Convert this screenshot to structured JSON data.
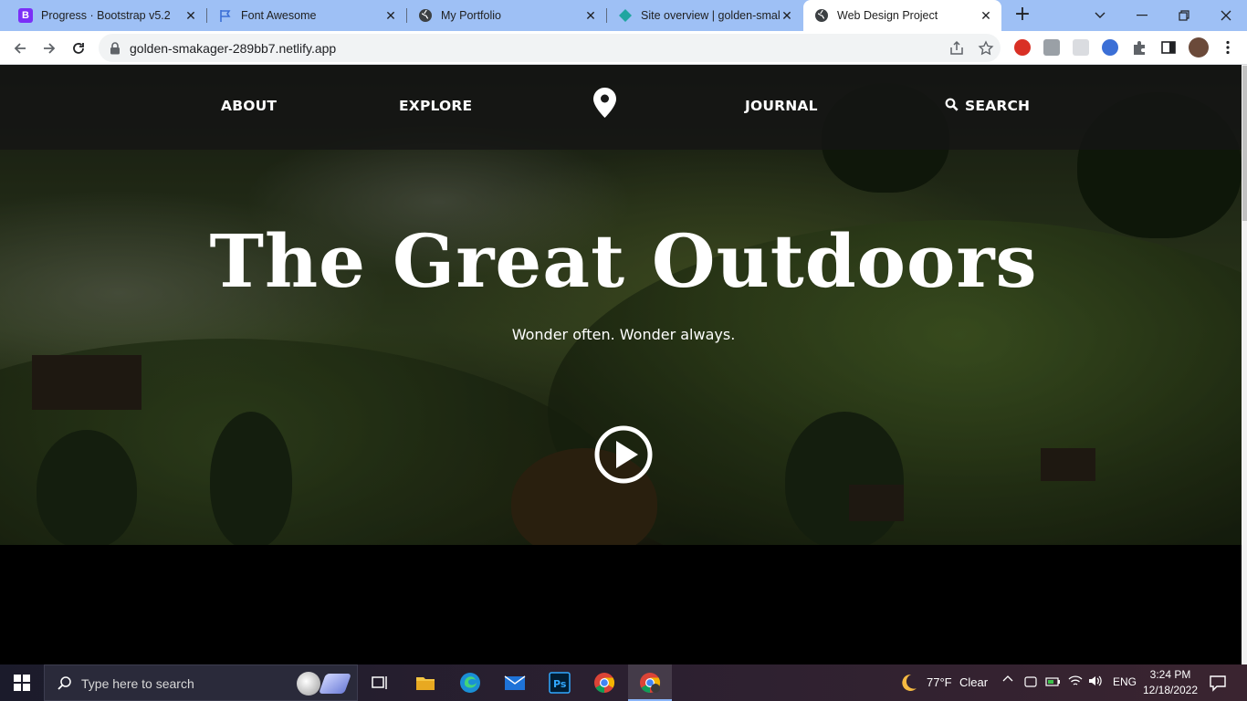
{
  "browser": {
    "tabs": [
      {
        "title": "Progress · Bootstrap v5.2",
        "icon": "bootstrap-icon"
      },
      {
        "title": "Font Awesome",
        "icon": "flag-icon"
      },
      {
        "title": "My Portfolio",
        "icon": "globe-icon"
      },
      {
        "title": "Site overview | golden-smakager",
        "icon": "netlify-icon"
      },
      {
        "title": "Web Design Project",
        "icon": "globe-icon",
        "active": true
      }
    ],
    "url": "golden-smakager-289bb7.netlify.app"
  },
  "site": {
    "nav": {
      "about": "ABOUT",
      "explore": "EXPLORE",
      "journal": "JOURNAL",
      "search": "SEARCH"
    },
    "headline": "The Great Outdoors",
    "tagline": "Wonder often. Wonder always."
  },
  "taskbar": {
    "search_placeholder": "Type here to search",
    "weather": {
      "temp": "77°F",
      "condition": "Clear"
    },
    "language": "ENG",
    "time": "3:24 PM",
    "date": "12/18/2022"
  },
  "colors": {
    "tab_strip": "#9ec0f5",
    "nav_overlay": "#141414",
    "headline": "#ffffff"
  }
}
